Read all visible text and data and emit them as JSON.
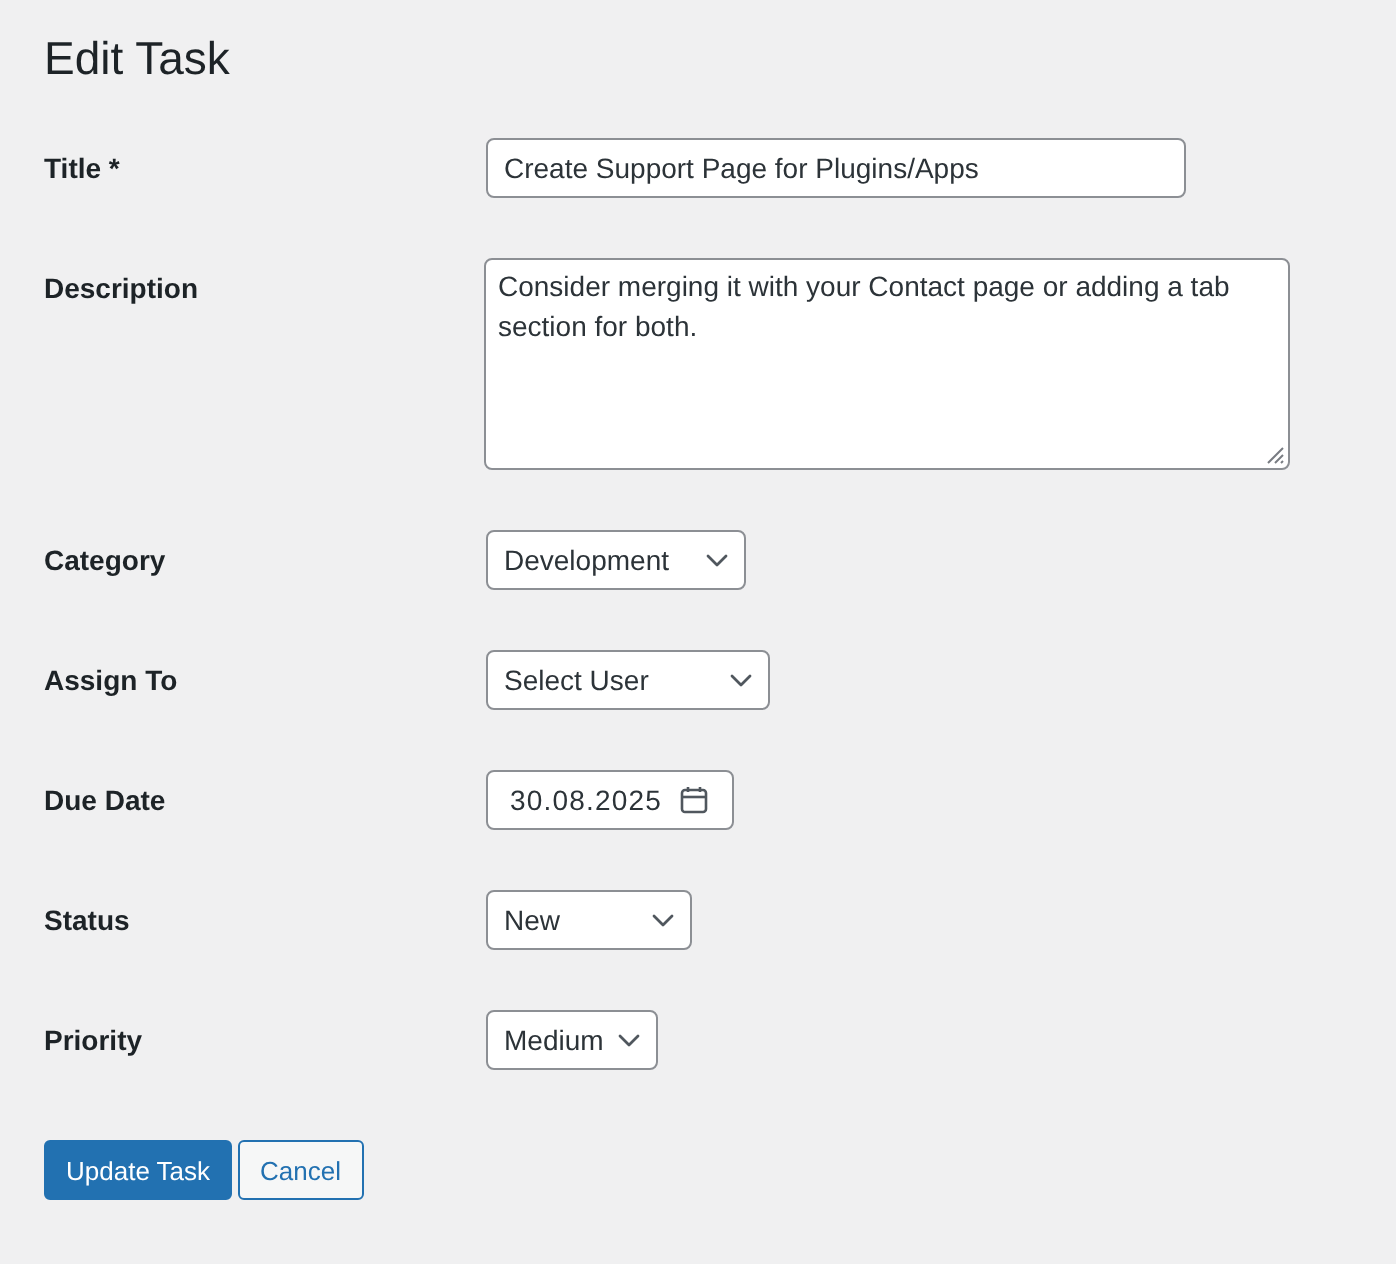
{
  "page": {
    "title": "Edit Task"
  },
  "fields": {
    "title": {
      "kind": "text",
      "label": "Title *",
      "value": "Create Support Page for Plugins/Apps"
    },
    "description": {
      "kind": "textarea",
      "label": "Description",
      "value": "Consider merging it with your Contact page or adding a tab section for both."
    },
    "category": {
      "kind": "select",
      "label": "Category",
      "value": "Development"
    },
    "assign_to": {
      "kind": "select",
      "label": "Assign To",
      "value": "Select User"
    },
    "due_date": {
      "kind": "date",
      "label": "Due Date",
      "value": "30.08.2025"
    },
    "status": {
      "kind": "select",
      "label": "Status",
      "value": "New"
    },
    "priority": {
      "kind": "select",
      "label": "Priority",
      "value": "Medium"
    }
  },
  "buttons": [
    {
      "kind": "primary",
      "label": "Update Task"
    },
    {
      "kind": "secondary",
      "label": "Cancel"
    }
  ]
}
